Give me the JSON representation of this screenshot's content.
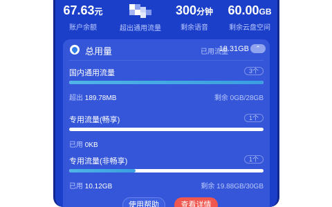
{
  "stats": [
    {
      "value_main": "67.63",
      "value_unit": "元",
      "label": "账户余额"
    },
    {
      "value_main": "",
      "value_unit": "",
      "label": "超出通用流量"
    },
    {
      "value_main": "300",
      "value_unit": "分钟",
      "label": "剩余语音"
    },
    {
      "value_main": "60.00",
      "value_unit": "GB",
      "label": "剩余云盘空间"
    }
  ],
  "panel": {
    "title": "总用量",
    "used_label": "已用流量",
    "used_value": "18.31GB",
    "collapse_glyph": "⌃"
  },
  "rows": [
    {
      "title": "国内通用流量",
      "count": "3个",
      "fill_percent": 100,
      "left_label": "超出",
      "left_value": "189.78MB",
      "right_label": "剩余",
      "right_value": "0GB/28GB"
    },
    {
      "title": "专用流量(畅享)",
      "count": "1个",
      "fill_percent": 0,
      "left_label": "已用",
      "left_value": "0KB",
      "right_label": "",
      "right_value": ""
    },
    {
      "title": "专用流量(非畅享)",
      "count": "1个",
      "fill_percent": 34,
      "left_label": "已用",
      "left_value": "10.12GB",
      "right_label": "剩余",
      "right_value": "19.88GB/30GB"
    }
  ],
  "buttons": {
    "help": "使用帮助",
    "detail": "查看详情"
  },
  "colors": {
    "background": "#1b3fc9",
    "panel": "#3556d8",
    "bar_fill": "#4fb5e6",
    "detail_button": "#f0574f"
  },
  "icons": {
    "panel_logo": "droplet-icon",
    "collapse": "chevron-up-icon"
  }
}
